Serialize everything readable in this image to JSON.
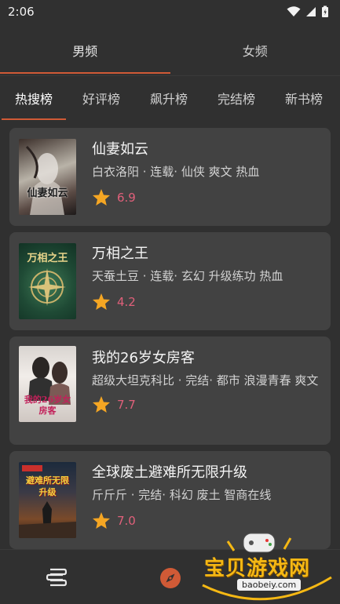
{
  "status_bar": {
    "time": "2:06"
  },
  "gender_tabs": [
    {
      "label": "男频",
      "active": true
    },
    {
      "label": "女频",
      "active": false
    }
  ],
  "rank_tabs": [
    {
      "label": "热搜榜",
      "active": true
    },
    {
      "label": "好评榜",
      "active": false
    },
    {
      "label": "飙升榜",
      "active": false
    },
    {
      "label": "完结榜",
      "active": false
    },
    {
      "label": "新书榜",
      "active": false
    }
  ],
  "books": [
    {
      "title": "仙妻如云",
      "meta": "白衣洛阳 · 连载· 仙侠 爽文 热血",
      "rating": "6.9",
      "cover_text": "仙妻如云"
    },
    {
      "title": "万相之王",
      "meta": "天蚕土豆 · 连载· 玄幻 升级练功 热血",
      "rating": "4.2",
      "cover_text": "万相之王"
    },
    {
      "title": "我的26岁女房客",
      "meta": "超级大坦克科比 · 完结· 都市 浪漫青春 爽文",
      "rating": "7.7",
      "cover_text": "我的26岁女房客"
    },
    {
      "title": "全球废土避难所无限升级",
      "meta": "斤斤斤 · 完结· 科幻 废土 智商在线",
      "rating": "7.0",
      "cover_text": "避难所无限升级"
    }
  ],
  "watermark": {
    "text": "宝贝游戏网",
    "url": "baobeiy.com"
  },
  "colors": {
    "accent": "#d05a36",
    "rating": "#e0607a",
    "star": "#f5a623",
    "card": "#424242",
    "background": "#303030"
  }
}
